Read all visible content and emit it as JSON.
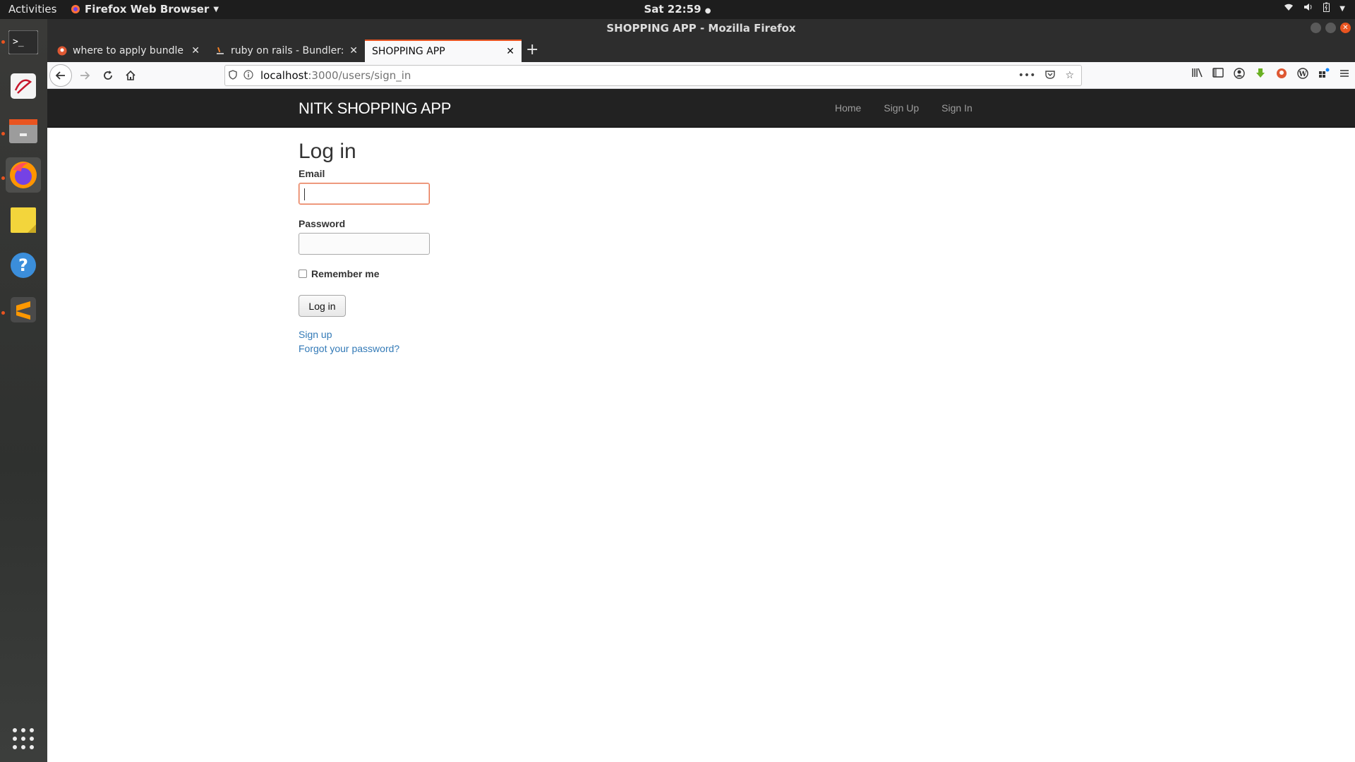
{
  "topbar": {
    "activities": "Activities",
    "app_menu": "Firefox Web Browser",
    "clock": "Sat 22:59"
  },
  "dock": {
    "items": [
      "terminal-icon",
      "text-editor-icon",
      "files-icon",
      "firefox-icon",
      "sticky-notes-icon",
      "help-icon",
      "sublime-text-icon"
    ],
    "show_apps": "show-apps-icon"
  },
  "window": {
    "title": "SHOPPING APP - Mozilla Firefox"
  },
  "tabs": [
    {
      "title": "where to apply bundle in"
    },
    {
      "title": "ruby on rails - Bundler::G"
    },
    {
      "title": "SHOPPING APP"
    }
  ],
  "urlbar": {
    "host": "localhost",
    "path": ":3000/users/sign_in"
  },
  "site": {
    "brand": "NITK SHOPPING APP",
    "nav": {
      "home": "Home",
      "sign_up": "Sign Up",
      "sign_in": "Sign In"
    }
  },
  "form": {
    "heading": "Log in",
    "email_label": "Email",
    "password_label": "Password",
    "remember_label": "Remember me",
    "submit_label": "Log in",
    "sign_up_link": "Sign up",
    "forgot_link": "Forgot your password?"
  },
  "colors": {
    "accent": "#e95420",
    "navbar": "#222222",
    "link": "#337ab7"
  }
}
